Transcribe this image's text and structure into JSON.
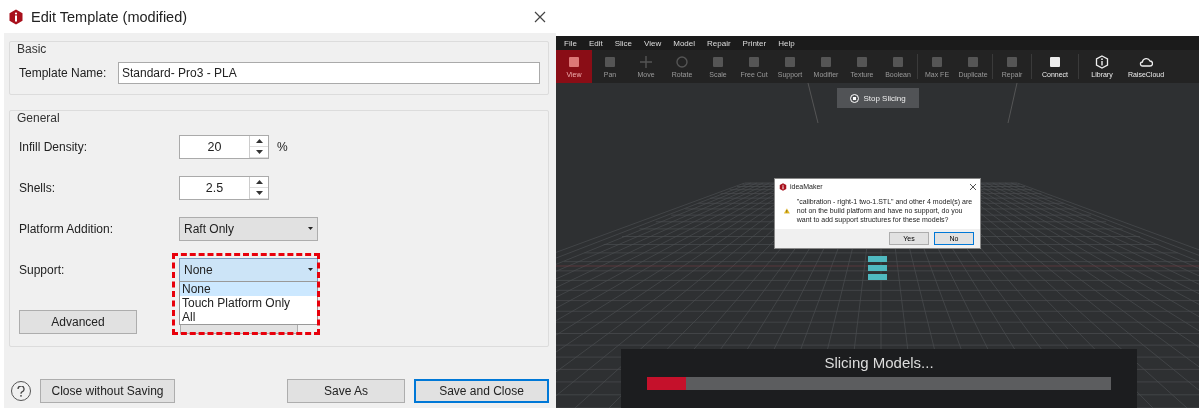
{
  "dialog": {
    "title": "Edit Template (modified)",
    "basic": {
      "heading": "Basic",
      "label": "Template Name:",
      "value": "Standard- Pro3 - PLA"
    },
    "general": {
      "heading": "General",
      "fields": [
        {
          "kind": "spin",
          "label": "Infill Density:",
          "value": "20",
          "unit": "%"
        },
        {
          "kind": "spin",
          "label": "Shells:",
          "value": "2.5"
        },
        {
          "kind": "dropdown",
          "label": "Platform Addition:",
          "value": "Raft Only",
          "expanded": false,
          "annotated": false
        },
        {
          "kind": "dropdown",
          "label": "Support:",
          "value": "None",
          "expanded": true,
          "annotated": true,
          "options": [
            {
              "label": "None",
              "selected": true
            },
            {
              "label": "Touch Platform Only",
              "selected": false
            },
            {
              "label": "All",
              "selected": false
            }
          ]
        }
      ],
      "advanced": "Advanced"
    },
    "footer": [
      {
        "label": "Close without Saving",
        "default": false
      },
      {
        "label": "Save As",
        "default": false
      },
      {
        "label": "Save and Close",
        "default": true
      }
    ]
  },
  "app": {
    "menu": [
      "File",
      "Edit",
      "Slice",
      "View",
      "Model",
      "Repair",
      "Printer",
      "Help"
    ],
    "toolbar": [
      {
        "label": "View",
        "selected": true,
        "disabled": false
      },
      {
        "label": "Pan",
        "selected": false,
        "disabled": true
      },
      {
        "label": "Move",
        "selected": false,
        "disabled": true
      },
      {
        "label": "Rotate",
        "selected": false,
        "disabled": true
      },
      {
        "label": "Scale",
        "selected": false,
        "disabled": true
      },
      {
        "label": "Free Cut",
        "selected": false,
        "disabled": true
      },
      {
        "label": "Support",
        "selected": false,
        "disabled": true
      },
      {
        "label": "Modifier",
        "selected": false,
        "disabled": true
      },
      {
        "label": "Texture",
        "selected": false,
        "disabled": true
      },
      {
        "label": "Boolean",
        "selected": false,
        "disabled": true
      },
      {
        "label": "Max FE",
        "selected": false,
        "disabled": true
      },
      {
        "label": "Duplicate",
        "selected": false,
        "disabled": true
      },
      {
        "label": "Repair",
        "selected": false,
        "disabled": true
      },
      {
        "label": "Connect",
        "selected": false,
        "disabled": false
      },
      {
        "label": "Library",
        "selected": false,
        "disabled": false
      },
      {
        "label": "RaiseCloud",
        "selected": false,
        "disabled": false
      }
    ],
    "stop_button": "Stop Slicing",
    "alert": {
      "title": "ideaMaker",
      "message": "\"calibration - right-1 two-1.STL\" and other 4 model(s) are not on the build platform and have no support, do you want to add support structures for these models?",
      "buttons": [
        {
          "label": "Yes",
          "default": false
        },
        {
          "label": "No",
          "default": true
        }
      ]
    },
    "progress": {
      "label": "Slicing Models...",
      "level": 0.085
    }
  }
}
